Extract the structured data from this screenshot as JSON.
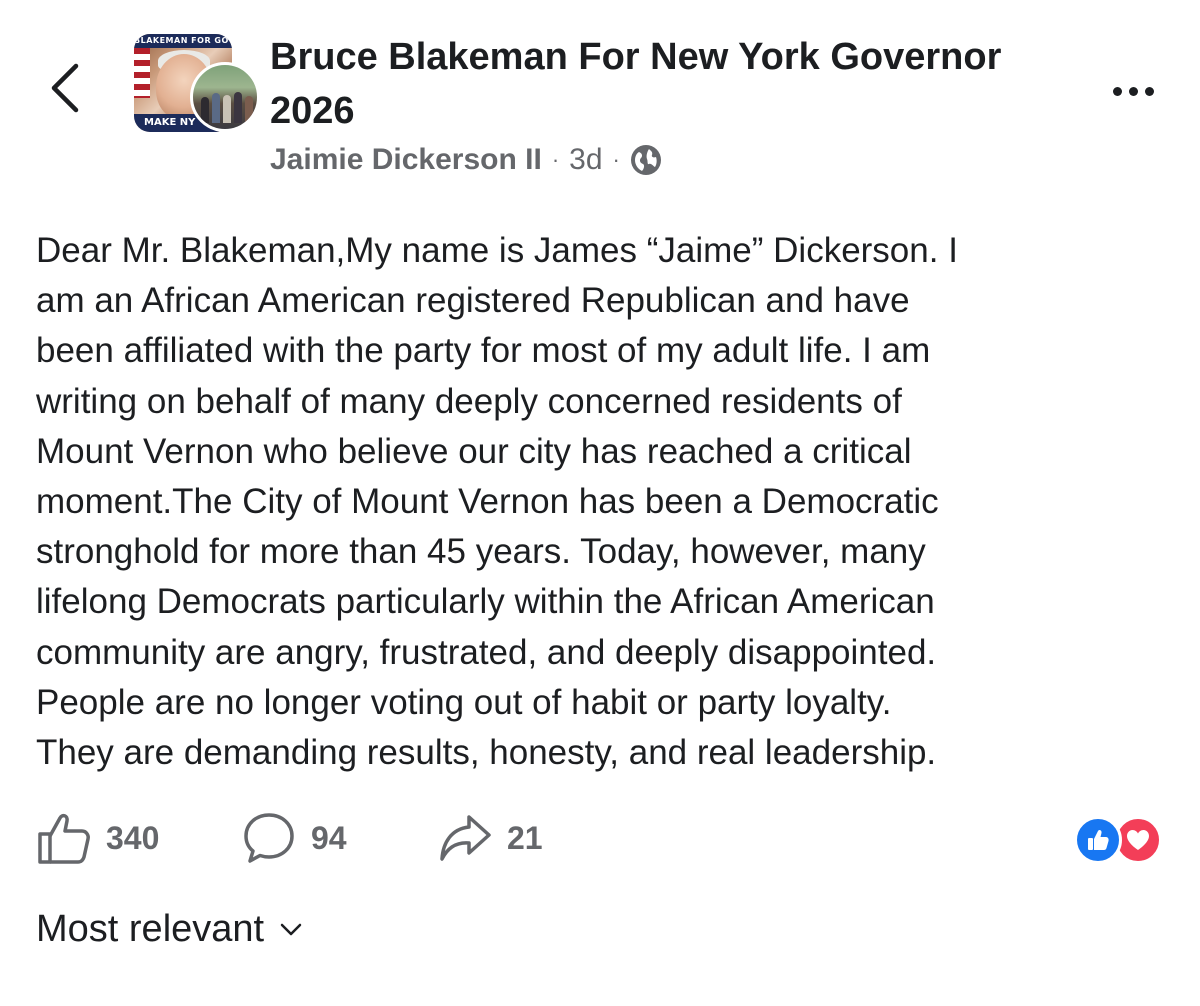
{
  "header": {
    "back_icon": "chevron-left-icon",
    "group_name": "Bruce Blakeman For New York Governor 2026",
    "avatar_banner_top": "BLAKEMAN FOR GOVERNOR",
    "avatar_banner_bottom": "MAKE NY",
    "more_icon": "more-horizontal-icon"
  },
  "meta": {
    "author": "Jaimie Dickerson II",
    "separator": "·",
    "time": "3d",
    "audience_icon": "globe-icon"
  },
  "post": {
    "text": "Dear Mr. Blakeman,My name is James “Jaime” Dickerson. I\nam an African American registered Republican and have\nbeen affiliated with the party for most of my adult life. I am\nwriting on behalf of many deeply concerned residents of\nMount Vernon who believe our city has reached a critical\nmoment.The City of Mount Vernon has been a Democratic\nstronghold for more than 45 years. Today, however, many\nlifelong Democrats particularly within the African American\ncommunity are angry, frustrated, and deeply disappointed.\nPeople are no longer voting out of habit or party loyalty.\nThey are demanding results, honesty, and real leadership."
  },
  "actions": {
    "like": {
      "icon": "thumbs-up-icon",
      "count": "340"
    },
    "comment": {
      "icon": "comment-bubble-icon",
      "count": "94"
    },
    "share": {
      "icon": "share-arrow-icon",
      "count": "21"
    }
  },
  "reactions": [
    "like-reaction-icon",
    "love-reaction-icon"
  ],
  "comments": {
    "sort_label": "Most relevant",
    "sort_icon": "chevron-down-icon"
  },
  "colors": {
    "text_primary": "#1c1e21",
    "text_secondary": "#65676b",
    "like_blue": "#1877f2",
    "love_red": "#f33e58"
  }
}
